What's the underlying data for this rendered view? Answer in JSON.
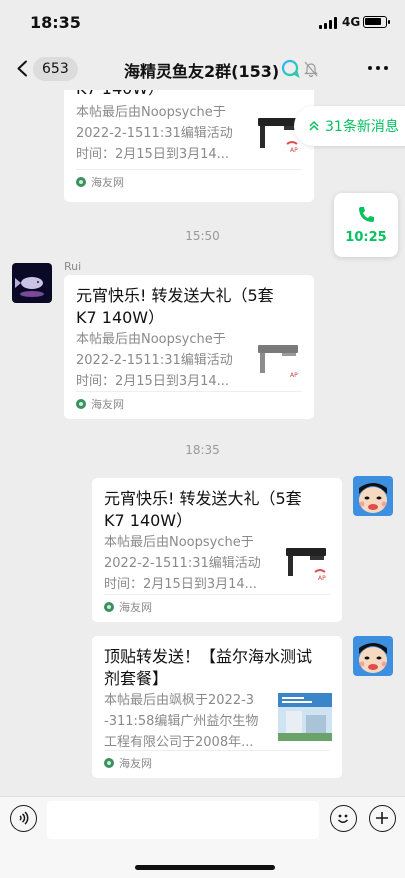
{
  "status_bar": {
    "time": "18:35",
    "network": "4G",
    "battery_level": 0.85
  },
  "nav": {
    "back_badge": "653",
    "title": "海精灵鱼友2群(153)"
  },
  "floating": {
    "new_messages": "31条新消息",
    "call_time": "10:25"
  },
  "messages": [
    {
      "type": "card_partial",
      "title_tail": "K7  140W）",
      "desc_lines": [
        "本帖最后由Noopsyche于",
        "2022-2-1511:31编辑活动",
        "时间：2月15日到3月14..."
      ],
      "source": "海友网"
    },
    {
      "type": "time",
      "text": "15:50"
    },
    {
      "type": "card",
      "sender": "Rui",
      "title_lines": [
        "元宵快乐! 转发送大礼（5套",
        "K7  140W）"
      ],
      "desc_lines": [
        "本帖最后由Noopsyche于",
        "2022-2-1511:31编辑活动",
        "时间：2月15日到3月14..."
      ],
      "source": "海友网"
    },
    {
      "type": "time",
      "text": "18:35"
    },
    {
      "type": "card",
      "title_lines": [
        "元宵快乐! 转发送大礼（5套",
        "K7  140W）"
      ],
      "desc_lines": [
        "本帖最后由Noopsyche于",
        "2022-2-1511:31编辑活动",
        "时间：2月15日到3月14..."
      ],
      "source": "海友网"
    },
    {
      "type": "card",
      "title_lines": [
        "顶贴转发送！【益尔海水测试",
        "剂套餐】"
      ],
      "desc_lines": [
        "本帖最后由飒枫于2022-3",
        "-311:58编辑广州益尔生物",
        "工程有限公司于2008年..."
      ],
      "source": "海友网"
    }
  ],
  "icons": {
    "back": "chevron-left-icon",
    "gpt": "chat-bubbles-icon",
    "mute": "bell-muted-icon",
    "more": "more-dots-icon",
    "new_messages": "double-chevron-up-icon",
    "call": "phone-icon",
    "source": "haiyou-logo-icon",
    "voice": "voice-icon",
    "emoji": "smiley-icon",
    "plus": "plus-icon"
  },
  "colors": {
    "accent": "#07c160",
    "chat_bg": "#ededed",
    "card_bg": "#ffffff",
    "meta_gray": "#8a8a8a"
  }
}
